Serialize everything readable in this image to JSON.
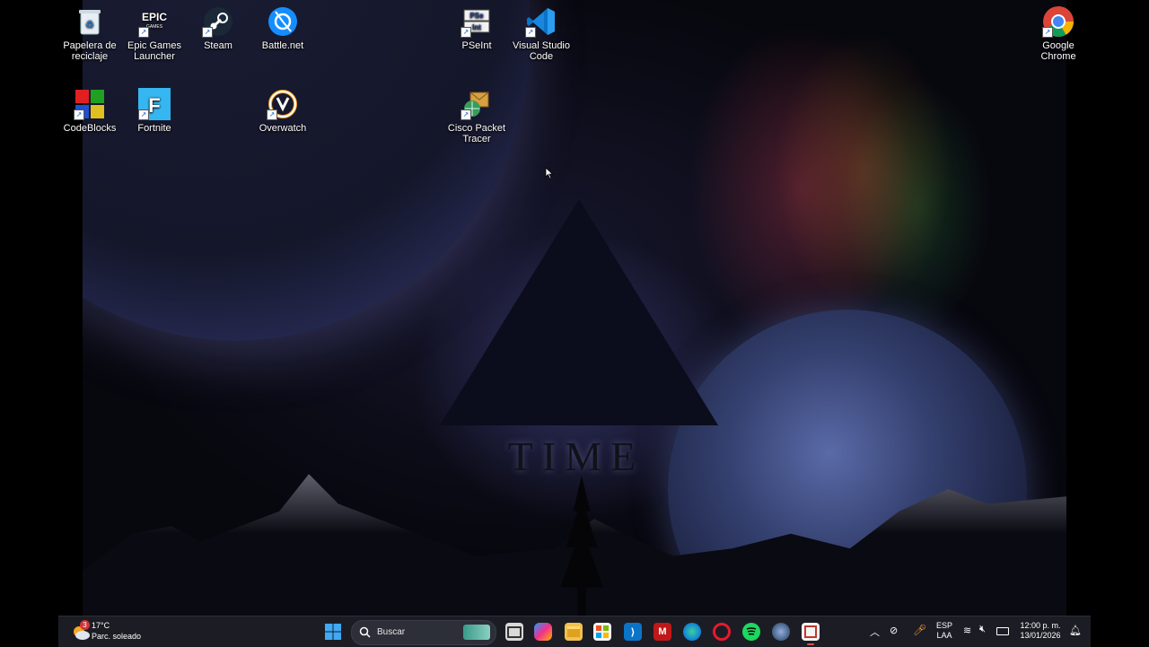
{
  "desktop": {
    "icons": [
      {
        "label": "Papelera de reciclaje",
        "icon": "recycle-bin-icon"
      },
      {
        "label": "Epic Games Launcher",
        "icon": "epic-games-icon"
      },
      {
        "label": "Steam",
        "icon": "steam-icon"
      },
      {
        "label": "Battle.net",
        "icon": "battlenet-icon"
      },
      {
        "label": "PSeInt",
        "icon": "pseint-icon"
      },
      {
        "label": "Visual Studio Code",
        "icon": "vscode-icon"
      },
      {
        "label": "Google Chrome",
        "icon": "chrome-icon"
      },
      {
        "label": "CodeBlocks",
        "icon": "codeblocks-icon"
      },
      {
        "label": "Fortnite",
        "icon": "fortnite-icon"
      },
      {
        "label": "Overwatch",
        "icon": "overwatch-icon"
      },
      {
        "label": "Cisco Packet Tracer",
        "icon": "cisco-packet-tracer-icon"
      }
    ],
    "wallpaper_text": "TIME"
  },
  "taskbar": {
    "weather": {
      "temp": "17°C",
      "condition": "Parc. soleado",
      "badge": "3"
    },
    "search_placeholder": "Buscar",
    "apps": [
      "windows-start",
      "search",
      "widgets-bar",
      "task-view",
      "copilot",
      "file-explorer",
      "microsoft-store",
      "vscode",
      "mcafee",
      "edge",
      "opera",
      "spotify",
      "network-app",
      "snipping-tool"
    ],
    "tray": {
      "language_top": "ESP",
      "language_bottom": "LAA",
      "time": "12:00 p. m.",
      "date": "13/01/2026"
    },
    "accent": "#0078d4"
  }
}
